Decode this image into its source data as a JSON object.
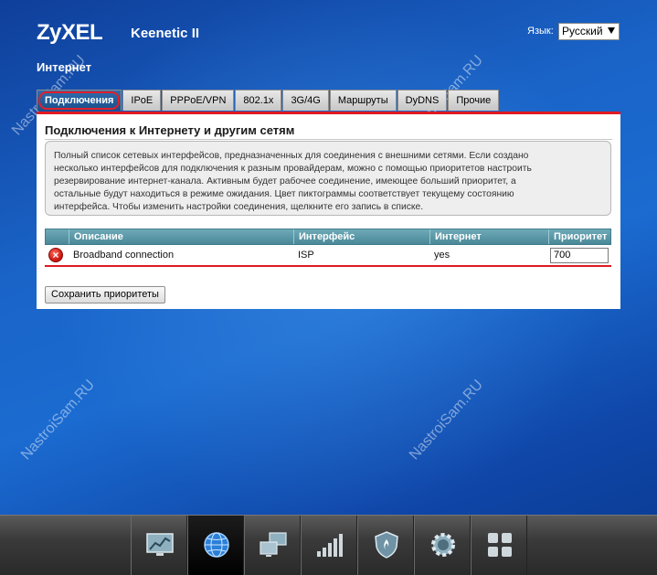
{
  "header": {
    "logo": "ZyXEL",
    "model": "Keenetic II",
    "language_label": "Язык:",
    "language_value": "Русский"
  },
  "section_title": "Интернет",
  "tabs": [
    {
      "label": "Подключения",
      "active": true
    },
    {
      "label": "IPoE"
    },
    {
      "label": "PPPoE/VPN"
    },
    {
      "label": "802.1x"
    },
    {
      "label": "3G/4G"
    },
    {
      "label": "Маршруты"
    },
    {
      "label": "DyDNS"
    },
    {
      "label": "Прочие"
    }
  ],
  "panel": {
    "title": "Подключения к Интернету и другим сетям",
    "info_lines": [
      "Полный список сетевых интерфейсов, предназначенных для соединения с внешними сетями. Если создано",
      "несколько интерфейсов для подключения к разным провайдерам, можно с помощью приоритетов настроить",
      "резервирование интернет-канала. Активным будет рабочее соединение, имеющее больший приоритет, а",
      "остальные будут находиться в режиме ожидания. Цвет пиктограммы соответствует текущему состоянию",
      "интерфейса. Чтобы изменить настройки соединения, щелкните его запись в списке."
    ]
  },
  "table": {
    "headers": [
      "Описание",
      "Интерфейс",
      "Интернет",
      "Приоритет"
    ],
    "rows": [
      {
        "status_icon": "error-icon",
        "description": "Broadband connection",
        "interface": "ISP",
        "internet": "yes",
        "priority": "700"
      }
    ]
  },
  "save_button": "Сохранить приоритеты",
  "watermarks": [
    "NastroiSam.RU",
    "NastroiSam.RU",
    "NastroiSam.RU",
    "NastroiSam.RU",
    "NastroiSam.RU"
  ],
  "dock": [
    {
      "icon": "monitor-chart-icon"
    },
    {
      "icon": "globe-icon",
      "active": true
    },
    {
      "icon": "network-computers-icon"
    },
    {
      "icon": "signal-bars-icon"
    },
    {
      "icon": "shield-icon"
    },
    {
      "icon": "gear-icon"
    },
    {
      "icon": "apps-grid-icon"
    }
  ],
  "colors": {
    "accent_red": "#e01a20",
    "active_tab": "#1a4f8a",
    "table_header": "#5a97a7"
  }
}
